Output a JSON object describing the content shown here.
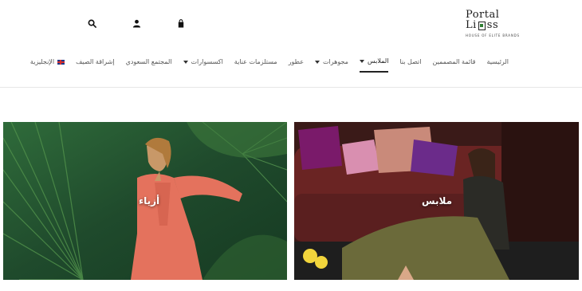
{
  "logo": {
    "line1": "Portal",
    "line2": "Li",
    "line2_tail": "ss",
    "tagline": "HOUSE OF ELITE BRANDS"
  },
  "header_icons": [
    "search-icon",
    "user-icon",
    "bag-icon"
  ],
  "nav": {
    "items": [
      {
        "label": "الرئيسية",
        "active": false,
        "dropdown": false
      },
      {
        "label": "قائمة المصممين",
        "active": false,
        "dropdown": false
      },
      {
        "label": "اتصل بنا",
        "active": false,
        "dropdown": false
      },
      {
        "label": "الملابس",
        "active": true,
        "dropdown": true
      },
      {
        "label": "مجوهرات",
        "active": false,
        "dropdown": true
      },
      {
        "label": "عطور",
        "active": false,
        "dropdown": false
      },
      {
        "label": "مستلزمات عناية",
        "active": false,
        "dropdown": false
      },
      {
        "label": "اكسسوارات",
        "active": false,
        "dropdown": true
      },
      {
        "label": "المجتمع السعودي",
        "active": false,
        "dropdown": false
      },
      {
        "label": "إشراقة الصيف",
        "active": false,
        "dropdown": false
      }
    ],
    "language": "الإنجليزية"
  },
  "cards": {
    "left": {
      "label": "أزياء"
    },
    "right": {
      "label": "ملابس"
    }
  },
  "colors": {
    "accent": "#222222",
    "logo_green": "#2e7d32",
    "fashion_bg": "#1f4a2c",
    "clothes_bg": "#5a1f1f"
  }
}
